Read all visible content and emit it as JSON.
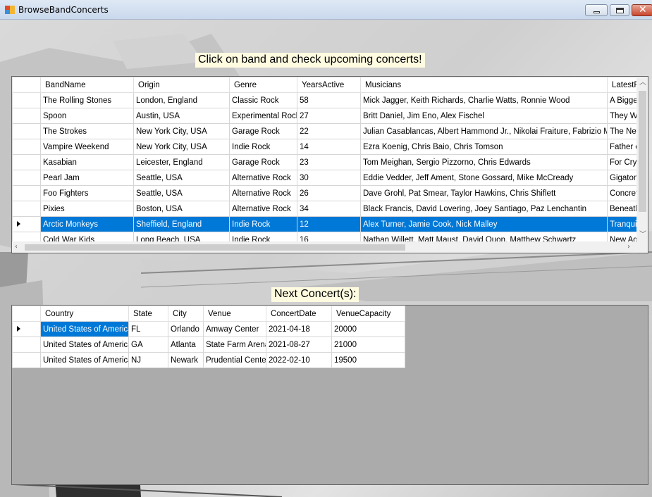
{
  "window": {
    "title": "BrowseBandConcerts"
  },
  "labels": {
    "bands_prompt": "Click on band and check upcoming concerts!",
    "next_concerts": "Next Concert(s):"
  },
  "bands_grid": {
    "columns": [
      "BandName",
      "Origin",
      "Genre",
      "YearsActive",
      "Musicians",
      "LatestR"
    ],
    "rows": [
      [
        "The Rolling Stones",
        "London, England",
        "Classic Rock",
        "58",
        "Mick Jagger, Keith Richards, Charlie Watts, Ronnie Wood",
        "A Bigger"
      ],
      [
        "Spoon",
        "Austin, USA",
        "Experimental Rock",
        "27",
        "Britt Daniel, Jim Eno, Alex Fischel",
        "They W"
      ],
      [
        "The Strokes",
        "New York City, USA",
        "Garage Rock",
        "22",
        "Julian Casablancas, Albert Hammond Jr., Nikolai Fraiture, Fabrizio Moretti",
        "The New"
      ],
      [
        "Vampire Weekend",
        "New York City, USA",
        "Indie Rock",
        "14",
        "Ezra Koenig, Chris Baio, Chris Tomson",
        "Father o"
      ],
      [
        "Kasabian",
        "Leicester, England",
        "Garage Rock",
        "23",
        "Tom Meighan, Sergio Pizzorno, Chris Edwards",
        "For Cryin"
      ],
      [
        "Pearl Jam",
        "Seattle, USA",
        "Alternative Rock",
        "30",
        "Eddie Vedder, Jeff Ament, Stone Gossard, Mike McCready",
        "Gigaton"
      ],
      [
        "Foo Fighters",
        "Seattle, USA",
        "Alternative Rock",
        "26",
        "Dave Grohl, Pat Smear, Taylor Hawkins, Chris Shiflett",
        "Concrete"
      ],
      [
        "Pixies",
        "Boston, USA",
        "Alternative Rock",
        "34",
        "Black Francis, David Lovering, Joey Santiago, Paz Lenchantin",
        "Beneath"
      ],
      [
        "Arctic Monkeys",
        "Sheffield, England",
        "Indie Rock",
        "12",
        "Alex Turner, Jamie Cook, Nick Malley",
        "Tranquil"
      ],
      [
        "Cold War Kids",
        "Long Beach, USA",
        "Indie Rock",
        "16",
        "Nathan Willett, Matt Maust, David Quon, Matthew Schwartz",
        "New Ag"
      ]
    ],
    "selected_row": 8
  },
  "concerts_grid": {
    "columns": [
      "Country",
      "State",
      "City",
      "Venue",
      "ConcertDate",
      "VenueCapacity"
    ],
    "rows": [
      [
        "United States of America",
        "FL",
        "Orlando",
        "Amway Center",
        "2021-04-18",
        "20000"
      ],
      [
        "United States of America",
        "GA",
        "Atlanta",
        "State Farm Arena",
        "2021-08-27",
        "21000"
      ],
      [
        "United States of America",
        "NJ",
        "Newark",
        "Prudential Center",
        "2022-02-10",
        "19500"
      ]
    ],
    "selected_row": 0
  },
  "colors": {
    "selection": "#0078d7",
    "label_bg": "#fffbe0"
  }
}
